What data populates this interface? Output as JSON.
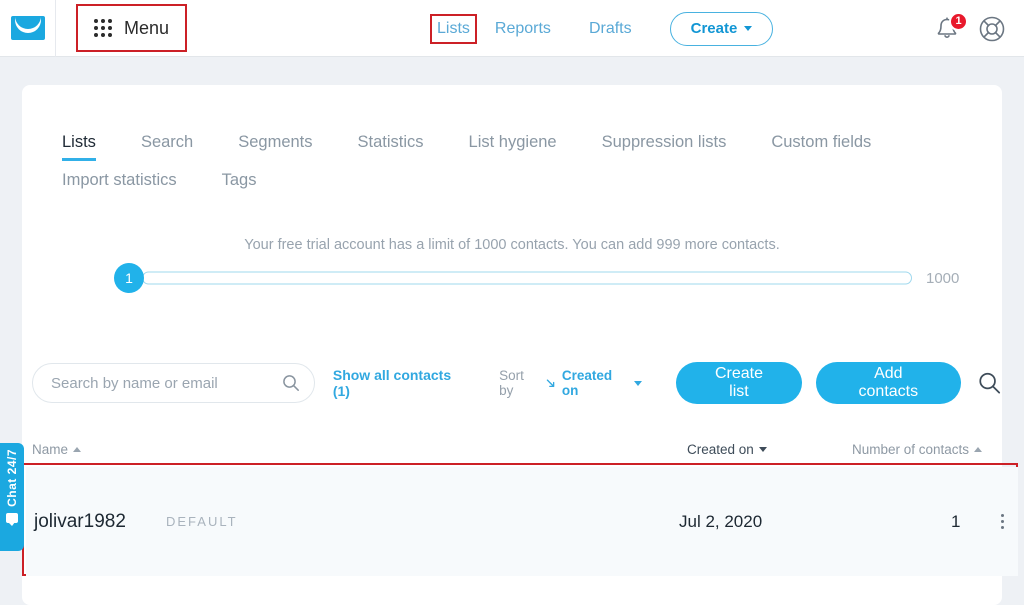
{
  "topbar": {
    "logo_name": "envelope-logo",
    "menu_label": "Menu",
    "nav": [
      {
        "label": "Lists",
        "highlighted": true
      },
      {
        "label": "Reports",
        "highlighted": false
      },
      {
        "label": "Drafts",
        "highlighted": false
      }
    ],
    "create_label": "Create",
    "notifications_count": "1"
  },
  "tabs": {
    "row1": [
      {
        "label": "Lists",
        "active": true
      },
      {
        "label": "Search",
        "active": false
      },
      {
        "label": "Segments",
        "active": false
      },
      {
        "label": "Statistics",
        "active": false
      },
      {
        "label": "List hygiene",
        "active": false
      },
      {
        "label": "Suppression lists",
        "active": false
      },
      {
        "label": "Custom fields",
        "active": false
      }
    ],
    "row2": [
      {
        "label": "Import statistics",
        "active": false
      },
      {
        "label": "Tags",
        "active": false
      }
    ]
  },
  "trial": {
    "notice": "Your free trial account has a limit of 1000 contacts. You can add 999 more contacts.",
    "current_value": "1",
    "max_value": "1000"
  },
  "toolbar": {
    "search_placeholder": "Search by name or email",
    "search_value": "",
    "show_all_label": "Show all contacts (1)",
    "sort_by_label": "Sort by",
    "sort_by_value": "Created on",
    "create_list_label": "Create list",
    "add_contacts_label": "Add contacts"
  },
  "table": {
    "headers": {
      "name": "Name",
      "created_on": "Created on",
      "number_of_contacts": "Number of contacts"
    },
    "rows": [
      {
        "name": "jolivar1982",
        "badge": "DEFAULT",
        "created_on": "Jul 2, 2020",
        "contacts": "1"
      }
    ]
  },
  "chat_widget": {
    "label": "Chat 24/7"
  },
  "colors": {
    "brand_blue": "#21b2ea",
    "annotation_red": "#cc2026",
    "badge_red": "#e8192c",
    "page_bg": "#eef1f5"
  }
}
